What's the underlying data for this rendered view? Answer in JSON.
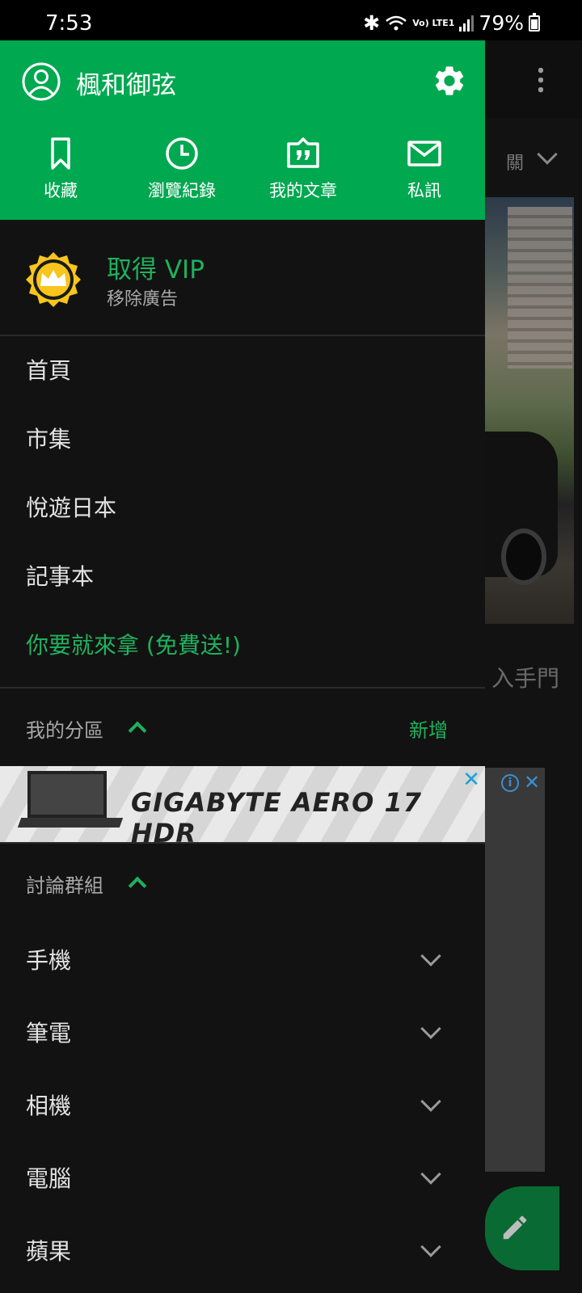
{
  "status_bar": {
    "time": "7:53",
    "network": "Vo) LTE1",
    "battery": "79%"
  },
  "drawer": {
    "username": "楓和御弦",
    "quick_actions": [
      {
        "label": "收藏",
        "icon": "bookmark-icon"
      },
      {
        "label": "瀏覽紀錄",
        "icon": "history-clock-icon"
      },
      {
        "label": "我的文章",
        "icon": "article-quote-icon"
      },
      {
        "label": "私訊",
        "icon": "mail-icon"
      }
    ],
    "vip": {
      "title": "取得 VIP",
      "subtitle": "移除廣告"
    },
    "menu": [
      "首頁",
      "市集",
      "悅遊日本",
      "記事本",
      "你要就來拿 (免費送!)"
    ],
    "my_sections": {
      "label": "我的分區",
      "add": "新增"
    },
    "ad": {
      "text": "GIGABYTE AERO 17 HDR",
      "close": "✕"
    },
    "groups": {
      "label": "討論群組",
      "items": [
        "手機",
        "筆電",
        "相機",
        "電腦",
        "蘋果"
      ]
    }
  },
  "background": {
    "tab_partial": "關",
    "title_partial": "入手門",
    "ad_close": "✕"
  },
  "colors": {
    "primary": "#00a850",
    "accent_text": "#1fb15d",
    "drawer_bg": "#121212"
  }
}
